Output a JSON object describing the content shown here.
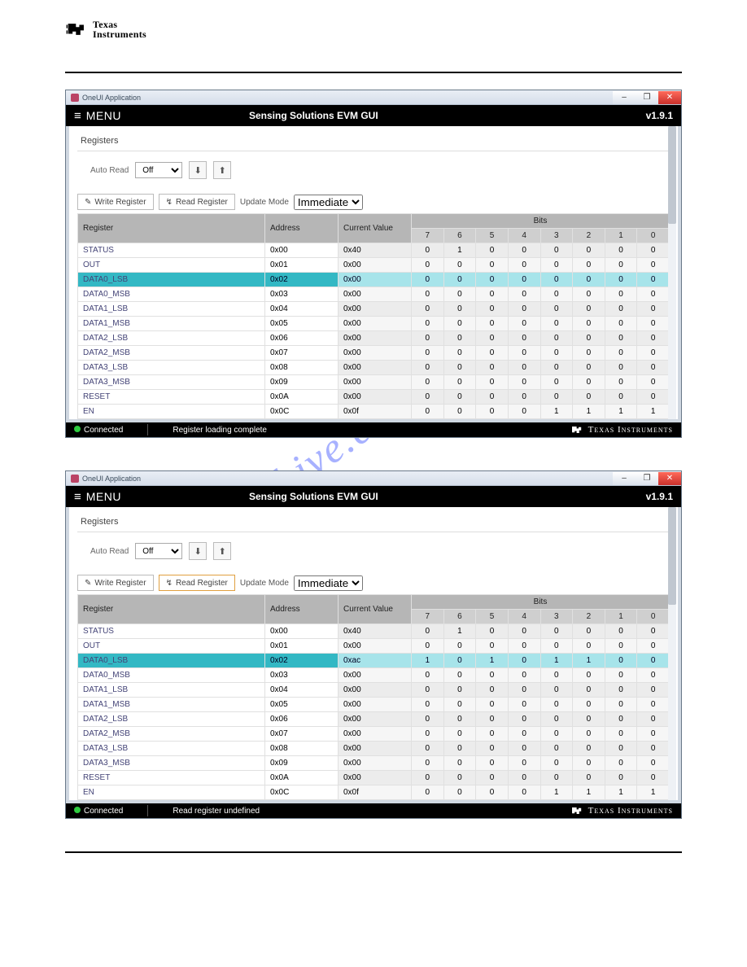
{
  "doc": {
    "brand_top": "Texas",
    "brand_bot": "Instruments",
    "watermark": "manualshive.com"
  },
  "window": {
    "title": "OneUI Application",
    "minimize": "–",
    "maximize": "❐",
    "close": "✕"
  },
  "app": {
    "menu_label": "MENU",
    "gui_title": "Sensing Solutions EVM GUI",
    "version": "v1.9.1",
    "section": "Registers",
    "autoread_label": "Auto Read",
    "autoread_value": "Off",
    "download_icon": "⬇",
    "upload_icon": "⬆",
    "write_btn": "Write Register",
    "read_btn": "Read Register",
    "update_mode_label": "Update Mode",
    "update_mode_value": "Immediate",
    "pencil": "✎",
    "lightning": "↯"
  },
  "table": {
    "col_register": "Register",
    "col_address": "Address",
    "col_current": "Current Value",
    "col_bits": "Bits",
    "bit_labels": [
      "7",
      "6",
      "5",
      "4",
      "3",
      "2",
      "1",
      "0"
    ]
  },
  "footer": {
    "connected": "Connected",
    "ti_text": "Texas Instruments"
  },
  "shot1": {
    "status_msg": "Register loading complete",
    "rows": [
      {
        "name": "STATUS",
        "addr": "0x00",
        "val": "0x40",
        "bits": [
          "0",
          "1",
          "0",
          "0",
          "0",
          "0",
          "0",
          "0"
        ],
        "sel": false
      },
      {
        "name": "OUT",
        "addr": "0x01",
        "val": "0x00",
        "bits": [
          "0",
          "0",
          "0",
          "0",
          "0",
          "0",
          "0",
          "0"
        ],
        "sel": false
      },
      {
        "name": "DATA0_LSB",
        "addr": "0x02",
        "val": "0x00",
        "bits": [
          "0",
          "0",
          "0",
          "0",
          "0",
          "0",
          "0",
          "0"
        ],
        "sel": true
      },
      {
        "name": "DATA0_MSB",
        "addr": "0x03",
        "val": "0x00",
        "bits": [
          "0",
          "0",
          "0",
          "0",
          "0",
          "0",
          "0",
          "0"
        ],
        "sel": false
      },
      {
        "name": "DATA1_LSB",
        "addr": "0x04",
        "val": "0x00",
        "bits": [
          "0",
          "0",
          "0",
          "0",
          "0",
          "0",
          "0",
          "0"
        ],
        "sel": false
      },
      {
        "name": "DATA1_MSB",
        "addr": "0x05",
        "val": "0x00",
        "bits": [
          "0",
          "0",
          "0",
          "0",
          "0",
          "0",
          "0",
          "0"
        ],
        "sel": false
      },
      {
        "name": "DATA2_LSB",
        "addr": "0x06",
        "val": "0x00",
        "bits": [
          "0",
          "0",
          "0",
          "0",
          "0",
          "0",
          "0",
          "0"
        ],
        "sel": false
      },
      {
        "name": "DATA2_MSB",
        "addr": "0x07",
        "val": "0x00",
        "bits": [
          "0",
          "0",
          "0",
          "0",
          "0",
          "0",
          "0",
          "0"
        ],
        "sel": false
      },
      {
        "name": "DATA3_LSB",
        "addr": "0x08",
        "val": "0x00",
        "bits": [
          "0",
          "0",
          "0",
          "0",
          "0",
          "0",
          "0",
          "0"
        ],
        "sel": false
      },
      {
        "name": "DATA3_MSB",
        "addr": "0x09",
        "val": "0x00",
        "bits": [
          "0",
          "0",
          "0",
          "0",
          "0",
          "0",
          "0",
          "0"
        ],
        "sel": false
      },
      {
        "name": "RESET",
        "addr": "0x0A",
        "val": "0x00",
        "bits": [
          "0",
          "0",
          "0",
          "0",
          "0",
          "0",
          "0",
          "0"
        ],
        "sel": false
      },
      {
        "name": "EN",
        "addr": "0x0C",
        "val": "0x0f",
        "bits": [
          "0",
          "0",
          "0",
          "0",
          "1",
          "1",
          "1",
          "1"
        ],
        "sel": false
      }
    ]
  },
  "shot2": {
    "status_msg": "Read register undefined",
    "read_highlight": true,
    "rows": [
      {
        "name": "STATUS",
        "addr": "0x00",
        "val": "0x40",
        "bits": [
          "0",
          "1",
          "0",
          "0",
          "0",
          "0",
          "0",
          "0"
        ],
        "sel": false
      },
      {
        "name": "OUT",
        "addr": "0x01",
        "val": "0x00",
        "bits": [
          "0",
          "0",
          "0",
          "0",
          "0",
          "0",
          "0",
          "0"
        ],
        "sel": false
      },
      {
        "name": "DATA0_LSB",
        "addr": "0x02",
        "val": "0xac",
        "bits": [
          "1",
          "0",
          "1",
          "0",
          "1",
          "1",
          "0",
          "0"
        ],
        "sel": true
      },
      {
        "name": "DATA0_MSB",
        "addr": "0x03",
        "val": "0x00",
        "bits": [
          "0",
          "0",
          "0",
          "0",
          "0",
          "0",
          "0",
          "0"
        ],
        "sel": false
      },
      {
        "name": "DATA1_LSB",
        "addr": "0x04",
        "val": "0x00",
        "bits": [
          "0",
          "0",
          "0",
          "0",
          "0",
          "0",
          "0",
          "0"
        ],
        "sel": false
      },
      {
        "name": "DATA1_MSB",
        "addr": "0x05",
        "val": "0x00",
        "bits": [
          "0",
          "0",
          "0",
          "0",
          "0",
          "0",
          "0",
          "0"
        ],
        "sel": false
      },
      {
        "name": "DATA2_LSB",
        "addr": "0x06",
        "val": "0x00",
        "bits": [
          "0",
          "0",
          "0",
          "0",
          "0",
          "0",
          "0",
          "0"
        ],
        "sel": false
      },
      {
        "name": "DATA2_MSB",
        "addr": "0x07",
        "val": "0x00",
        "bits": [
          "0",
          "0",
          "0",
          "0",
          "0",
          "0",
          "0",
          "0"
        ],
        "sel": false
      },
      {
        "name": "DATA3_LSB",
        "addr": "0x08",
        "val": "0x00",
        "bits": [
          "0",
          "0",
          "0",
          "0",
          "0",
          "0",
          "0",
          "0"
        ],
        "sel": false
      },
      {
        "name": "DATA3_MSB",
        "addr": "0x09",
        "val": "0x00",
        "bits": [
          "0",
          "0",
          "0",
          "0",
          "0",
          "0",
          "0",
          "0"
        ],
        "sel": false
      },
      {
        "name": "RESET",
        "addr": "0x0A",
        "val": "0x00",
        "bits": [
          "0",
          "0",
          "0",
          "0",
          "0",
          "0",
          "0",
          "0"
        ],
        "sel": false
      },
      {
        "name": "EN",
        "addr": "0x0C",
        "val": "0x0f",
        "bits": [
          "0",
          "0",
          "0",
          "0",
          "1",
          "1",
          "1",
          "1"
        ],
        "sel": false
      }
    ]
  }
}
